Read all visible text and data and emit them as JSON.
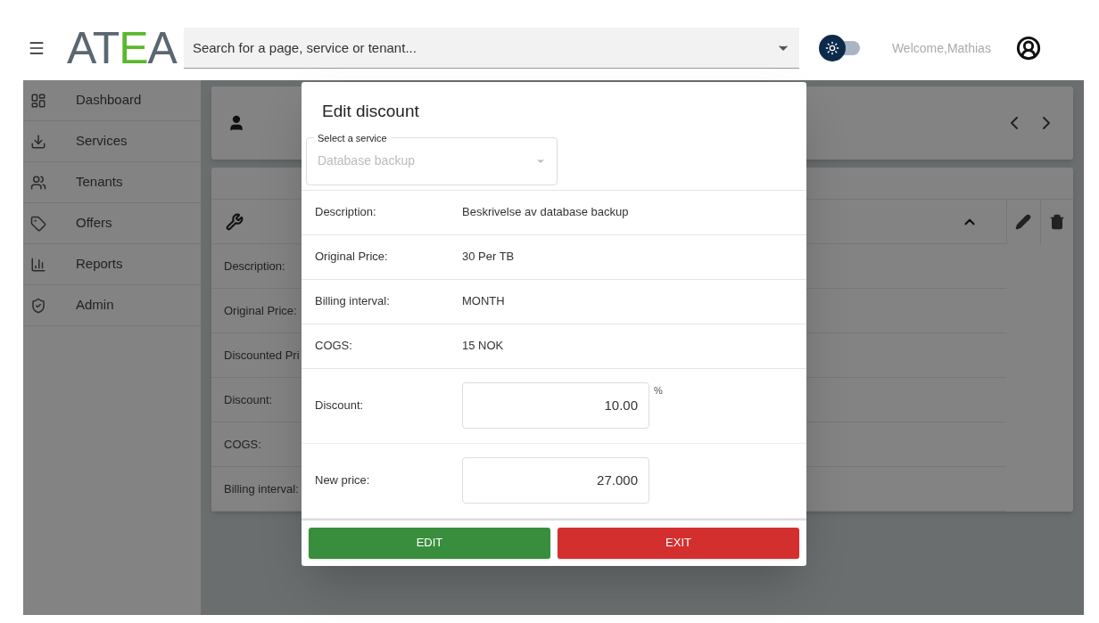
{
  "header": {
    "logo": [
      {
        "text": "AT",
        "color": "#5b6770"
      },
      {
        "text": "E",
        "color": "#5ab82e"
      },
      {
        "text": "A",
        "color": "#5b6770"
      }
    ],
    "search": {
      "placeholder": "Search for a page, service or tenant..."
    },
    "theme_toggle": {
      "on": false
    },
    "welcome": "Welcome,Mathias"
  },
  "sidebar": {
    "items": [
      {
        "label": "Dashboard"
      },
      {
        "label": "Services"
      },
      {
        "label": "Tenants"
      },
      {
        "label": "Offers"
      },
      {
        "label": "Reports"
      },
      {
        "label": "Admin"
      }
    ]
  },
  "service_card": {
    "expanded": true,
    "rows": [
      "Description:",
      "Original Price:",
      "Discounted Pri",
      "Discount:",
      "COGS:",
      "Billing interval:"
    ]
  },
  "dialog": {
    "title": "Edit discount",
    "service_select": {
      "label": "Select a service",
      "value": "Database backup",
      "disabled": true
    },
    "info_rows": [
      {
        "label": "Description:",
        "value": "Beskrivelse av database backup"
      },
      {
        "label": "Original Price:",
        "value": "30 Per TB"
      },
      {
        "label": "Billing interval:",
        "value": "MONTH"
      },
      {
        "label": "COGS:",
        "value": "15 NOK"
      }
    ],
    "inputs": [
      {
        "label": "Discount:",
        "value": "10.00",
        "suffix": "%"
      },
      {
        "label": "New price:",
        "value": "27.000"
      }
    ],
    "buttons": [
      {
        "label": "EDIT",
        "kind": "confirm"
      },
      {
        "label": "EXIT",
        "kind": "cancel"
      }
    ]
  }
}
